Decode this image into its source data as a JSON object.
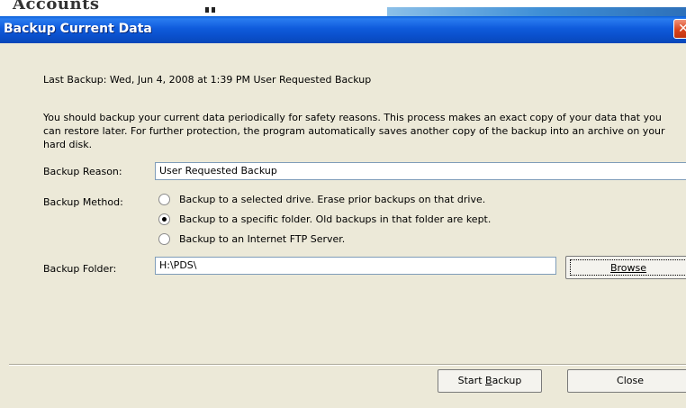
{
  "background_window": {
    "partial_text": "Accounts"
  },
  "dialog": {
    "title": "Backup Current Data",
    "close_glyph": "✕",
    "last_backup": "Last Backup: Wed, Jun 4, 2008 at 1:39 PM  User Requested Backup",
    "description": "You should backup your current data periodically for safety reasons.  This process makes an exact copy of your data that you can restore later.  For further protection, the program automatically saves another copy of the backup into an archive on your hard disk.",
    "backup_reason": {
      "label": "Backup Reason:",
      "value": "User Requested Backup"
    },
    "backup_method": {
      "label": "Backup Method:",
      "options": [
        {
          "label": "Backup to a selected drive.  Erase prior backups on that drive.",
          "selected": false
        },
        {
          "label": "Backup to a specific folder.  Old backups in that folder are kept.",
          "selected": true
        },
        {
          "label": "Backup to an Internet FTP Server.",
          "selected": false
        }
      ]
    },
    "backup_folder": {
      "label": "Backup Folder:",
      "value": "H:\\PDS\\"
    },
    "buttons": {
      "browse": "Browse",
      "start_backup_prefix": "Start ",
      "start_backup_mnemonic": "B",
      "start_backup_suffix": "ackup",
      "close": "Close"
    }
  },
  "colors": {
    "titlebar": "#0a4fcb",
    "dialog_face": "#ece9d8",
    "close_button": "#d9431c"
  }
}
